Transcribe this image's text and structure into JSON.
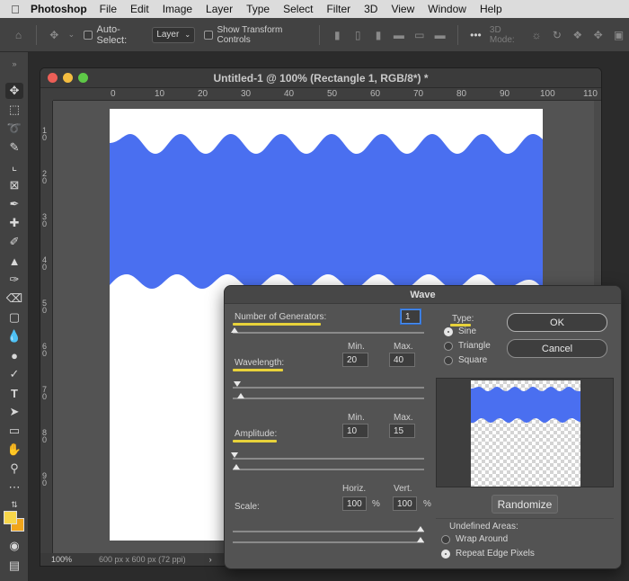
{
  "menubar": {
    "apple_icon": "apple-logo-icon",
    "app": "Photoshop",
    "items": [
      "File",
      "Edit",
      "Image",
      "Layer",
      "Type",
      "Select",
      "Filter",
      "3D",
      "View",
      "Window",
      "Help"
    ]
  },
  "options": {
    "auto_select_label": "Auto-Select:",
    "auto_select_value": "Layer",
    "show_transform_label": "Show Transform Controls",
    "three_d_mode_label": "3D Mode:"
  },
  "document": {
    "title": "Untitled-1 @ 100% (Rectangle 1, RGB/8*) *",
    "ruler_h": [
      "0",
      "10",
      "20",
      "30",
      "40",
      "50",
      "60",
      "70",
      "80",
      "90",
      "100",
      "110"
    ],
    "ruler_v": [
      "1",
      "0",
      "2",
      "0",
      "3",
      "0",
      "4",
      "0",
      "5",
      "0",
      "6",
      "0",
      "7",
      "0",
      "8",
      "0",
      "9",
      "0"
    ],
    "zoom": "100%",
    "doc_info": "600 px x 600 px (72 ppi)",
    "wave_color": "#4a6ff0"
  },
  "wave_dialog": {
    "title": "Wave",
    "generators_label": "Number of Generators:",
    "generators_value": "1",
    "wavelength_label": "Wavelength:",
    "wavelength_min": "20",
    "wavelength_max": "40",
    "amplitude_label": "Amplitude:",
    "amplitude_min": "10",
    "amplitude_max": "15",
    "min_label": "Min.",
    "max_label": "Max.",
    "scale_label": "Scale:",
    "horiz_label": "Horiz.",
    "vert_label": "Vert.",
    "scale_horiz": "100",
    "scale_vert": "100",
    "percent": "%",
    "type_label": "Type:",
    "types": [
      "Sine",
      "Triangle",
      "Square"
    ],
    "selected_type": "Sine",
    "ok_label": "OK",
    "cancel_label": "Cancel",
    "randomize_label": "Randomize",
    "undefined_label": "Undefined Areas:",
    "undefined_options": [
      "Wrap Around",
      "Repeat Edge Pixels"
    ],
    "selected_undefined": "Repeat Edge Pixels",
    "highlight_color": "#e8d23a"
  },
  "colors": {
    "foreground": "#f7d64a",
    "background": "#f1a51b"
  }
}
